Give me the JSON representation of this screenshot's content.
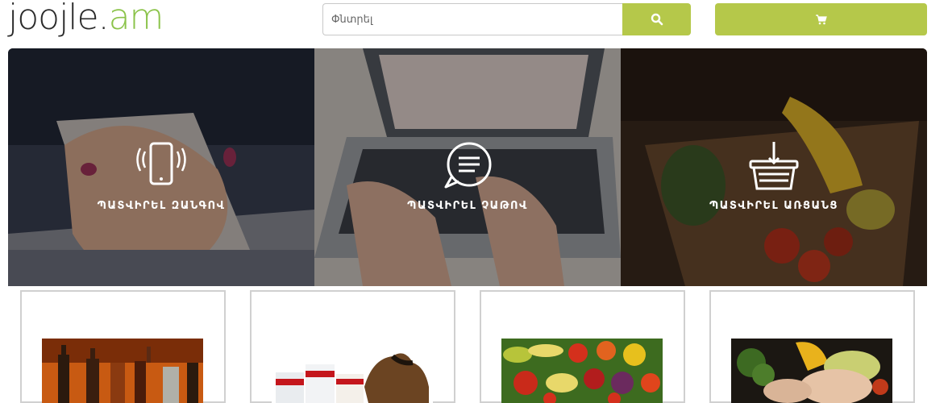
{
  "header": {
    "logo_main": "joojle.",
    "logo_tld": "am",
    "search": {
      "placeholder": "Փնտրել"
    },
    "search_icon": "search-icon",
    "cart_icon": "cart-icon"
  },
  "banner": {
    "panels": [
      {
        "label": "ՊԱՏՎԻՐԵԼ ԶԱՆԳՈՎ",
        "icon": "phone-call-icon"
      },
      {
        "label": "ՊԱՏՎԻՐԵԼ ՉԱԹՈՎ",
        "icon": "chat-bubble-icon"
      },
      {
        "label": "ՊԱՏՎԻՐԵԼ ԱՌՑԱՆՑ",
        "icon": "shopping-basket-icon"
      }
    ]
  },
  "products": [
    {
      "image": "bottles-image"
    },
    {
      "image": "pet-food-image"
    },
    {
      "image": "vegetables-image"
    },
    {
      "image": "meat-vegetables-image"
    }
  ],
  "colors": {
    "accent": "#b5c84a",
    "logo_green": "#8bc34a"
  }
}
